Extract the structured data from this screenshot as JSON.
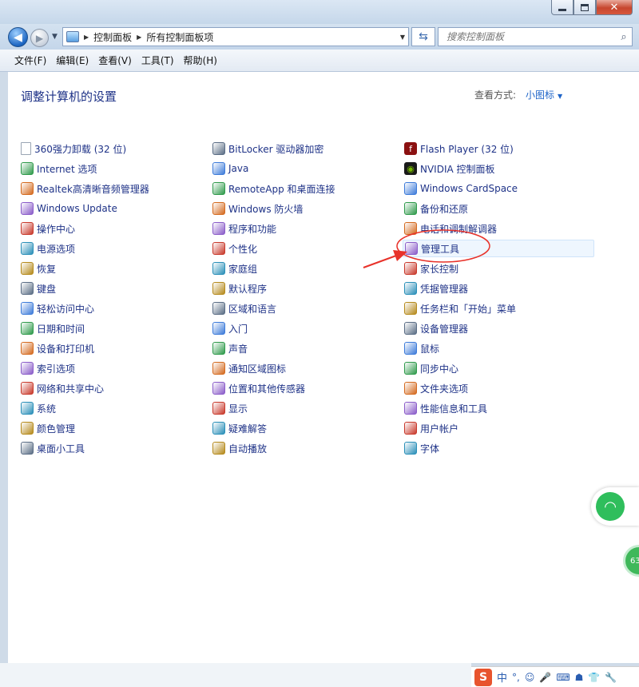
{
  "window": {
    "address": {
      "crumbs": [
        "控制面板",
        "所有控制面板项"
      ]
    },
    "search": {
      "placeholder": "搜索控制面板"
    }
  },
  "menubar": [
    "文件(F)",
    "编辑(E)",
    "查看(V)",
    "工具(T)",
    "帮助(H)"
  ],
  "header": {
    "title": "调整计算机的设置",
    "view_by_label": "查看方式:",
    "view_mode": "小图标"
  },
  "columns": [
    [
      {
        "label": "360强力卸载 (32 位)",
        "icon": "blank-doc-icon"
      },
      {
        "label": "Internet 选项",
        "icon": "internet-options-icon"
      },
      {
        "label": "Realtek高清晰音频管理器",
        "icon": "realtek-audio-icon"
      },
      {
        "label": "Windows Update",
        "icon": "windows-update-icon"
      },
      {
        "label": "操作中心",
        "icon": "action-center-flag-icon"
      },
      {
        "label": "电源选项",
        "icon": "power-options-icon"
      },
      {
        "label": "恢复",
        "icon": "recovery-icon"
      },
      {
        "label": "键盘",
        "icon": "keyboard-icon"
      },
      {
        "label": "轻松访问中心",
        "icon": "ease-of-access-icon"
      },
      {
        "label": "日期和时间",
        "icon": "date-time-icon"
      },
      {
        "label": "设备和打印机",
        "icon": "devices-printers-icon"
      },
      {
        "label": "索引选项",
        "icon": "indexing-icon"
      },
      {
        "label": "网络和共享中心",
        "icon": "network-icon"
      },
      {
        "label": "系统",
        "icon": "system-icon"
      },
      {
        "label": "颜色管理",
        "icon": "color-management-icon"
      },
      {
        "label": "桌面小工具",
        "icon": "gadgets-icon"
      }
    ],
    [
      {
        "label": "BitLocker 驱动器加密",
        "icon": "bitlocker-icon"
      },
      {
        "label": "Java",
        "icon": "java-icon"
      },
      {
        "label": "RemoteApp 和桌面连接",
        "icon": "remoteapp-icon"
      },
      {
        "label": "Windows 防火墙",
        "icon": "firewall-icon"
      },
      {
        "label": "程序和功能",
        "icon": "programs-icon"
      },
      {
        "label": "个性化",
        "icon": "personalization-icon"
      },
      {
        "label": "家庭组",
        "icon": "homegroup-icon"
      },
      {
        "label": "默认程序",
        "icon": "default-programs-icon"
      },
      {
        "label": "区域和语言",
        "icon": "region-language-icon"
      },
      {
        "label": "入门",
        "icon": "getting-started-icon"
      },
      {
        "label": "声音",
        "icon": "sound-icon"
      },
      {
        "label": "通知区域图标",
        "icon": "notification-icons-icon"
      },
      {
        "label": "位置和其他传感器",
        "icon": "sensors-icon"
      },
      {
        "label": "显示",
        "icon": "display-icon"
      },
      {
        "label": "疑难解答",
        "icon": "troubleshooting-icon"
      },
      {
        "label": "自动播放",
        "icon": "autoplay-icon"
      }
    ],
    [
      {
        "label": "Flash Player (32 位)",
        "icon": "flash-player-icon"
      },
      {
        "label": "NVIDIA 控制面板",
        "icon": "nvidia-icon"
      },
      {
        "label": "Windows CardSpace",
        "icon": "cardspace-icon"
      },
      {
        "label": "备份和还原",
        "icon": "backup-icon"
      },
      {
        "label": "电话和调制解调器",
        "icon": "phone-modem-icon"
      },
      {
        "label": "管理工具",
        "icon": "admin-tools-icon"
      },
      {
        "label": "家长控制",
        "icon": "parental-controls-icon"
      },
      {
        "label": "凭据管理器",
        "icon": "credential-icon"
      },
      {
        "label": "任务栏和「开始」菜单",
        "icon": "taskbar-icon"
      },
      {
        "label": "设备管理器",
        "icon": "device-manager-icon"
      },
      {
        "label": "鼠标",
        "icon": "mouse-icon"
      },
      {
        "label": "同步中心",
        "icon": "sync-icon"
      },
      {
        "label": "文件夹选项",
        "icon": "folder-options-icon"
      },
      {
        "label": "性能信息和工具",
        "icon": "performance-icon"
      },
      {
        "label": "用户帐户",
        "icon": "user-accounts-icon"
      },
      {
        "label": "字体",
        "icon": "fonts-icon"
      }
    ]
  ],
  "highlighted_item": "管理工具",
  "widgets": {
    "net_badge": "63"
  },
  "ime": {
    "mode": "中",
    "punct": "°,"
  },
  "colors": {
    "link": "#1e3287",
    "accent": "#1e64c8",
    "annotation": "#e8322a"
  }
}
